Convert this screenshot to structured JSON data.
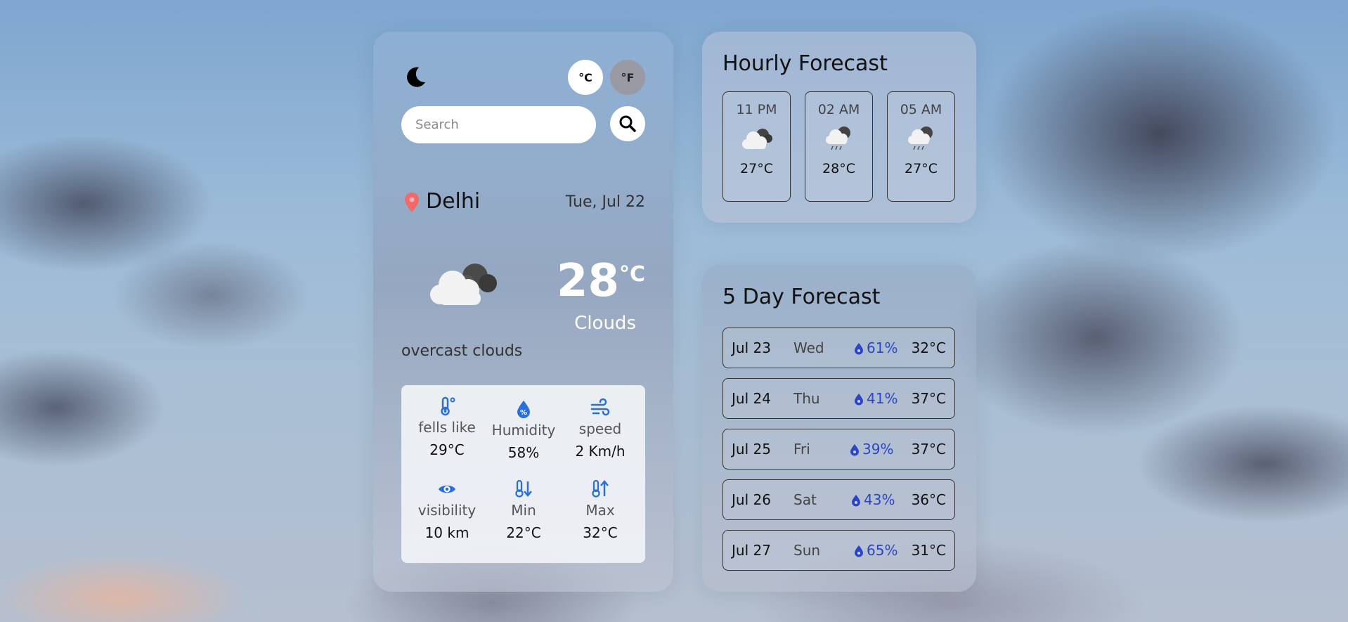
{
  "header": {
    "unit_celsius": "°C",
    "unit_fahrenheit": "°F"
  },
  "search": {
    "placeholder": "Search"
  },
  "current": {
    "city": "Delhi",
    "date": "Tue, Jul 22",
    "temperature": "28",
    "temp_unit": "°C",
    "condition": "Clouds",
    "description": "overcast clouds"
  },
  "stats": [
    {
      "label": "fells like",
      "value": "29°C",
      "icon": "thermometer-icon"
    },
    {
      "label": "Humidity",
      "value": "58%",
      "icon": "humidity-icon"
    },
    {
      "label": "speed",
      "value": "2 Km/h",
      "icon": "wind-icon"
    },
    {
      "label": "visibility",
      "value": "10 km",
      "icon": "eye-icon"
    },
    {
      "label": "Min",
      "value": "22°C",
      "icon": "temp-min-icon"
    },
    {
      "label": "Max",
      "value": "32°C",
      "icon": "temp-max-icon"
    }
  ],
  "hourly": {
    "title": "Hourly Forecast",
    "items": [
      {
        "time": "11 PM",
        "temp": "27°C",
        "icon": "cloudy-icon"
      },
      {
        "time": "02 AM",
        "temp": "28°C",
        "icon": "rain-cloud-icon"
      },
      {
        "time": "05 AM",
        "temp": "27°C",
        "icon": "rain-cloud-icon"
      }
    ]
  },
  "daily": {
    "title": "5 Day Forecast",
    "items": [
      {
        "date": "Jul 23",
        "day": "Wed",
        "rain": "61%",
        "temp": "32°C"
      },
      {
        "date": "Jul 24",
        "day": "Thu",
        "rain": "41%",
        "temp": "37°C"
      },
      {
        "date": "Jul 25",
        "day": "Fri",
        "rain": "39%",
        "temp": "37°C"
      },
      {
        "date": "Jul 26",
        "day": "Sat",
        "rain": "43%",
        "temp": "36°C"
      },
      {
        "date": "Jul 27",
        "day": "Sun",
        "rain": "65%",
        "temp": "31°C"
      }
    ]
  },
  "colors": {
    "accent_blue": "#2a6fdb",
    "rain_text": "#2a46c7",
    "pin": "#f06a6a"
  }
}
